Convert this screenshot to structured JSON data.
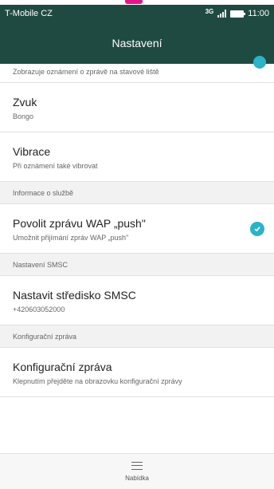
{
  "status": {
    "carrier": "T-Mobile CZ",
    "network": "3G",
    "time": "11:00"
  },
  "header": {
    "title": "Nastavení"
  },
  "list": {
    "clipped_sub": "Zobrazuje oznámení o zprávě na stavové liště",
    "sound": {
      "title": "Zvuk",
      "sub": "Bongo"
    },
    "vibration": {
      "title": "Vibrace",
      "sub": "Při oznámení také vibrovat"
    },
    "section_service": "Informace o službě",
    "wap": {
      "title": "Povolit zprávu WAP „push\"",
      "sub": "Umožnit přijímání zpráv WAP „push\"",
      "checked": true
    },
    "section_smsc": "Nastavení SMSC",
    "smsc": {
      "title": "Nastavit středisko SMSC",
      "sub": "+420603052000"
    },
    "section_config": "Konfigurační zpráva",
    "config": {
      "title": "Konfigurační zpráva",
      "sub": "Klepnutím přejděte na obrazovku konfigurační zprávy"
    }
  },
  "bottom": {
    "menu_label": "Nabídka"
  },
  "colors": {
    "app_bar": "#1f4a42",
    "accent": "#2bb3c7"
  }
}
